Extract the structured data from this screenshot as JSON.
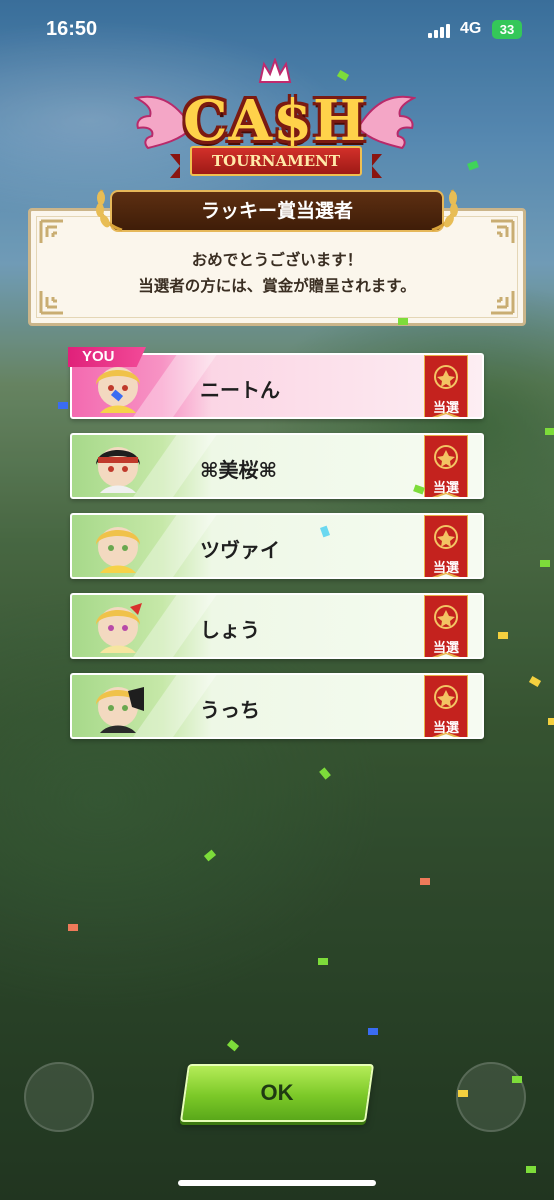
{
  "status_bar": {
    "time": "16:50",
    "network": "4G",
    "battery": "33"
  },
  "logo": {
    "title": "CA$H",
    "subtitle": "TOURNAMENT"
  },
  "winners_panel": {
    "header": "ラッキー賞当選者",
    "message_line1": "おめでとうございます！",
    "message_line2": "当選者の方には、賞金が贈呈されます。"
  },
  "you_tag": "YOU",
  "winners": [
    {
      "name": "ニートん",
      "badge": "当選",
      "is_you": true
    },
    {
      "name": "⌘美桜⌘",
      "badge": "当選",
      "is_you": false
    },
    {
      "name": "ツヴァイ",
      "badge": "当選",
      "is_you": false
    },
    {
      "name": "しょう",
      "badge": "当選",
      "is_you": false
    },
    {
      "name": "うっち",
      "badge": "当選",
      "is_you": false
    }
  ],
  "ok_button": {
    "label": "OK"
  },
  "colors": {
    "you_row": "#f793c4",
    "row": "#c6e8a8",
    "badge_red": "#c4221e",
    "ok_green": "#7cc928",
    "header_brown": "#5d2f12"
  }
}
